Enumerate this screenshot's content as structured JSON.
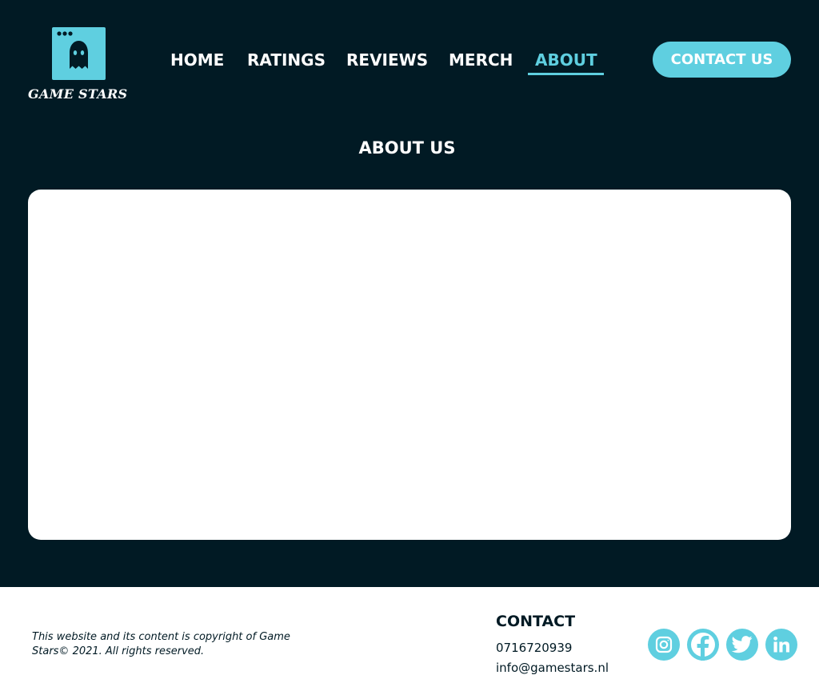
{
  "brand": {
    "name": "GAME STARS",
    "accent": "#5fcfe0",
    "background": "#011a24"
  },
  "nav": {
    "items": [
      {
        "label": "HOME"
      },
      {
        "label": "RATINGS"
      },
      {
        "label": "REVIEWS"
      },
      {
        "label": "MERCH"
      },
      {
        "label": "ABOUT",
        "active": true
      }
    ]
  },
  "header": {
    "contact_button": "CONTACT US"
  },
  "main": {
    "title": "ABOUT US"
  },
  "footer": {
    "copyright": "This website and its content is copyright of Game Stars© 2021. All rights reserved.",
    "contact": {
      "heading": "CONTACT",
      "phone": "0716720939",
      "email": "info@gamestars.nl"
    },
    "socials": [
      {
        "icon": "instagram-icon"
      },
      {
        "icon": "facebook-icon"
      },
      {
        "icon": "twitter-icon"
      },
      {
        "icon": "linkedin-icon"
      }
    ]
  }
}
